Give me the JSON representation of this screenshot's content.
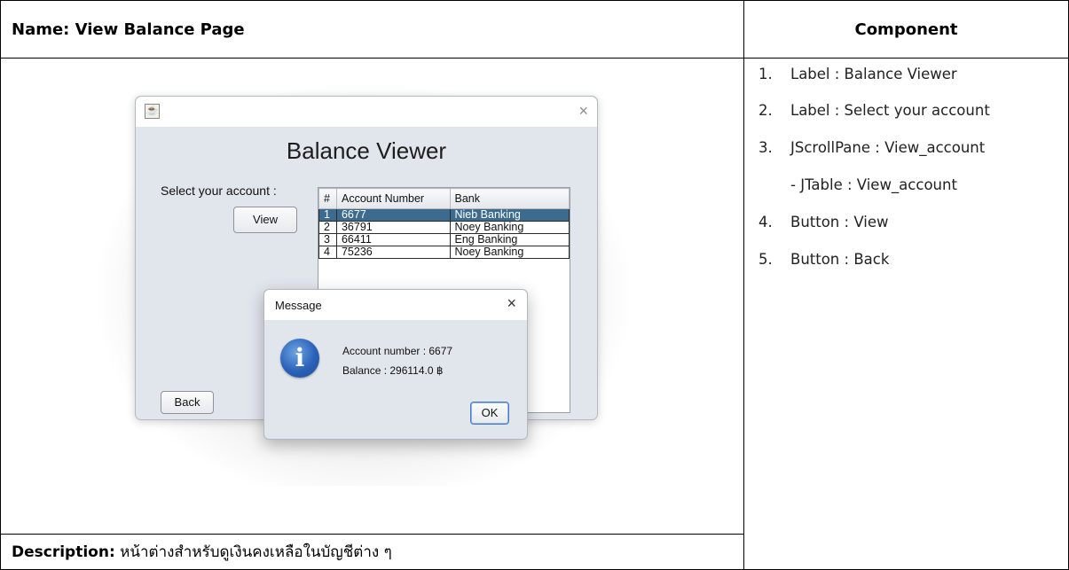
{
  "doc": {
    "header_name": "Name: View Balance Page",
    "header_component": "Component",
    "description_label": "Description:",
    "description_text": " หน้าต่างสำหรับดูเงินคงเหลือในบัญชีต่าง ๆ"
  },
  "components": [
    {
      "num": "1.",
      "text": "Label : Balance Viewer"
    },
    {
      "num": "2.",
      "text": "Label : Select your account"
    },
    {
      "num": "3.",
      "text": "JScrollPane : View_account"
    },
    {
      "num": "",
      "text": "- JTable : View_account"
    },
    {
      "num": "4.",
      "text": "Button : View"
    },
    {
      "num": "5.",
      "text": "Button : Back"
    }
  ],
  "window": {
    "title": "Balance Viewer",
    "select_label": "Select your account :",
    "view_button": "View",
    "back_button": "Back",
    "close_glyph": "×"
  },
  "table": {
    "headers": [
      "#",
      "Account Number",
      "Bank"
    ],
    "rows": [
      [
        "1",
        "6677",
        "Nieb Banking"
      ],
      [
        "2",
        "36791",
        "Noey Banking"
      ],
      [
        "3",
        "66411",
        "Eng Banking"
      ],
      [
        "4",
        "75236",
        "Noey Banking"
      ]
    ],
    "selected_row": 0
  },
  "message": {
    "title": "Message",
    "line1": "Account number : 6677",
    "line2": "Balance : 296114.0 ฿",
    "ok_button": "OK",
    "icon_glyph": "i",
    "close_glyph": "×"
  },
  "colors": {
    "selection": "#3c6b8f",
    "dialog_bg": "#e1e5ec",
    "info_icon": "#2a62b8"
  }
}
